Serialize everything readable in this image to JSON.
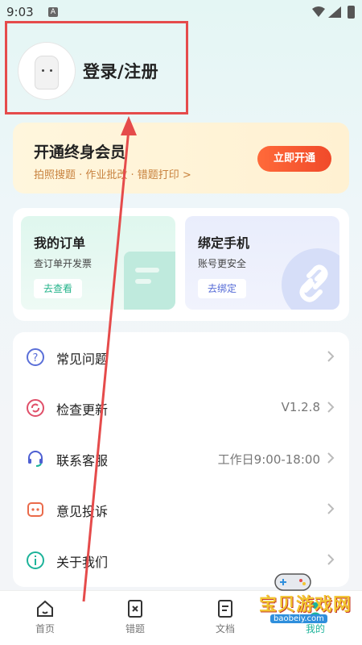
{
  "status_bar": {
    "time": "9:03",
    "app_indicator": "A"
  },
  "profile": {
    "login_label": "登录/注册"
  },
  "vip": {
    "title": "开通终身会员",
    "subtitle": "拍照搜题 · 作业批改 · 错题打印 >",
    "button_label": "立即开通"
  },
  "cards": {
    "orders": {
      "title": "我的订单",
      "subtitle": "查订单开发票",
      "button_label": "去查看"
    },
    "bind_phone": {
      "title": "绑定手机",
      "subtitle": "账号更安全",
      "button_label": "去绑定"
    }
  },
  "menu": {
    "items": [
      {
        "icon": "question-icon",
        "label": "常见问题",
        "value": ""
      },
      {
        "icon": "refresh-icon",
        "label": "检查更新",
        "value": "V1.2.8"
      },
      {
        "icon": "headset-icon",
        "label": "联系客服",
        "value": "工作日9:00-18:00"
      },
      {
        "icon": "chat-icon",
        "label": "意见投诉",
        "value": ""
      },
      {
        "icon": "info-icon",
        "label": "关于我们",
        "value": ""
      }
    ]
  },
  "bottom_nav": {
    "items": [
      {
        "icon": "home-icon",
        "label": "首页"
      },
      {
        "icon": "wrong-question-icon",
        "label": "错题"
      },
      {
        "icon": "document-icon",
        "label": "文档"
      },
      {
        "icon": "profile-icon",
        "label": "我的"
      }
    ]
  },
  "watermark": {
    "text": "宝贝游戏网",
    "url": "baobeiy.com"
  },
  "colors": {
    "accent": "#1db39a",
    "vip_button": "#f04a2a",
    "annotation": "#e54b4b"
  }
}
